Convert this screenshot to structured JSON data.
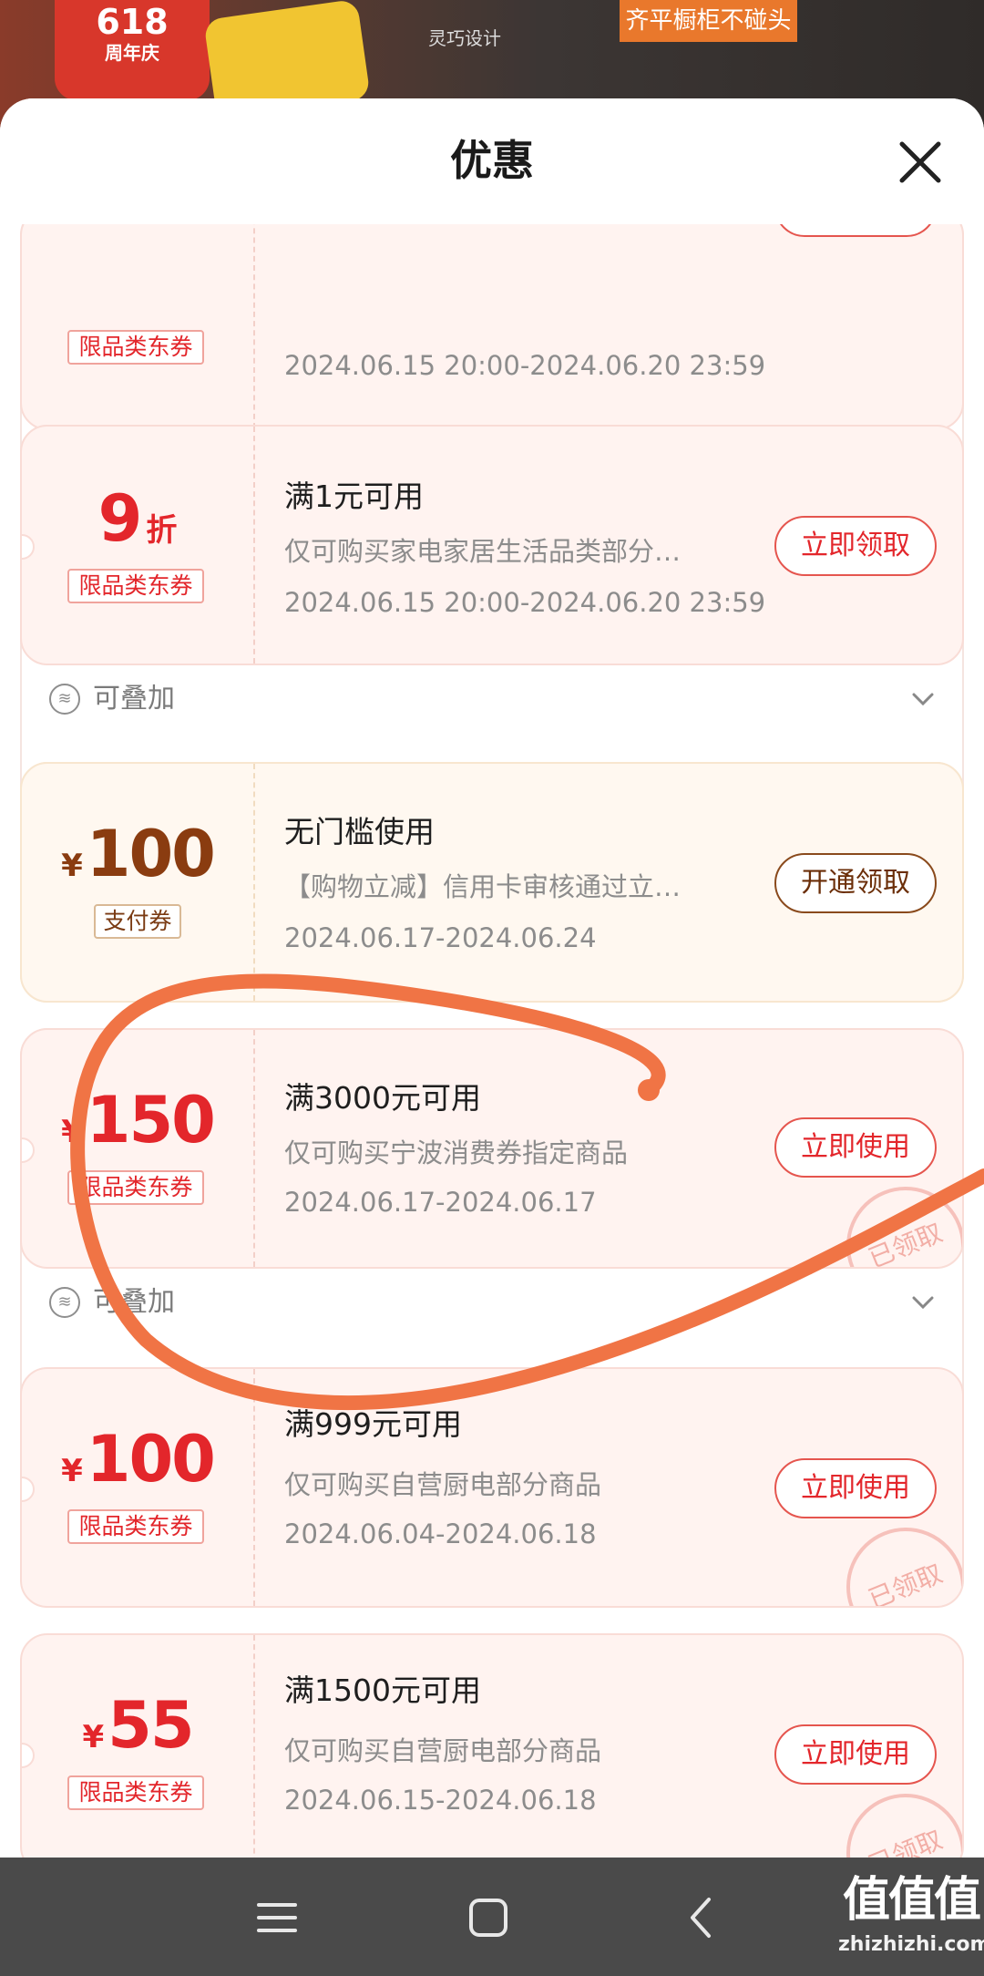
{
  "background": {
    "badge_number": "618",
    "badge_text": "周年庆",
    "brand_text": "灵巧设计",
    "slogan": "齐平橱柜不碰头"
  },
  "sheet": {
    "title": "优惠",
    "close_icon": "close-icon"
  },
  "stack_label": "可叠加",
  "coupons": [
    {
      "style": "red",
      "amount": "",
      "currency": "",
      "unit": "",
      "tag": "限品类东券",
      "condition": "",
      "description": "",
      "date": "2024.06.15 20:00-2024.06.20 23:59",
      "button": "",
      "stackable": true
    },
    {
      "style": "red",
      "amount": "9",
      "currency": "",
      "unit": "折",
      "tag": "限品类东券",
      "condition": "满1元可用",
      "description": "仅可购买家电家居生活品类部分…",
      "date": "2024.06.15 20:00-2024.06.20 23:59",
      "button": "立即领取",
      "stackable": true
    },
    {
      "style": "gold",
      "amount": "100",
      "currency": "¥",
      "unit": "",
      "tag": "支付券",
      "condition": "无门槛使用",
      "description": "【购物立减】信用卡审核通过立…",
      "date": "2024.06.17-2024.06.24",
      "button": "开通领取",
      "stackable": false
    },
    {
      "style": "red",
      "amount": "150",
      "currency": "¥",
      "unit": "",
      "tag": "限品类东券",
      "condition": "满3000元可用",
      "description": "仅可购买宁波消费券指定商品",
      "date": "2024.06.17-2024.06.17",
      "button": "立即使用",
      "stamp": "已领取",
      "stackable": true
    },
    {
      "style": "red",
      "amount": "100",
      "currency": "¥",
      "unit": "",
      "tag": "限品类东券",
      "condition": "满999元可用",
      "description": "仅可购买自营厨电部分商品",
      "date": "2024.06.04-2024.06.18",
      "button": "立即使用",
      "stamp": "已领取",
      "stackable": false
    },
    {
      "style": "red",
      "amount": "55",
      "currency": "¥",
      "unit": "",
      "tag": "限品类东券",
      "condition": "满1500元可用",
      "description": "仅可购买自营厨电部分商品",
      "date": "2024.06.15-2024.06.18",
      "button": "立即使用",
      "stamp": "已领取",
      "stackable": false
    }
  ],
  "navbar": {
    "recents_icon": "menu-lines-icon",
    "home_icon": "home-square-icon",
    "back_icon": "back-chevron-icon"
  },
  "watermark": {
    "main": "值值值",
    "site": "zhizhizhi.com"
  },
  "colors": {
    "accent_red": "#e3262b",
    "gold_text": "#8a3c10",
    "annotation_orange": "#f07445"
  }
}
